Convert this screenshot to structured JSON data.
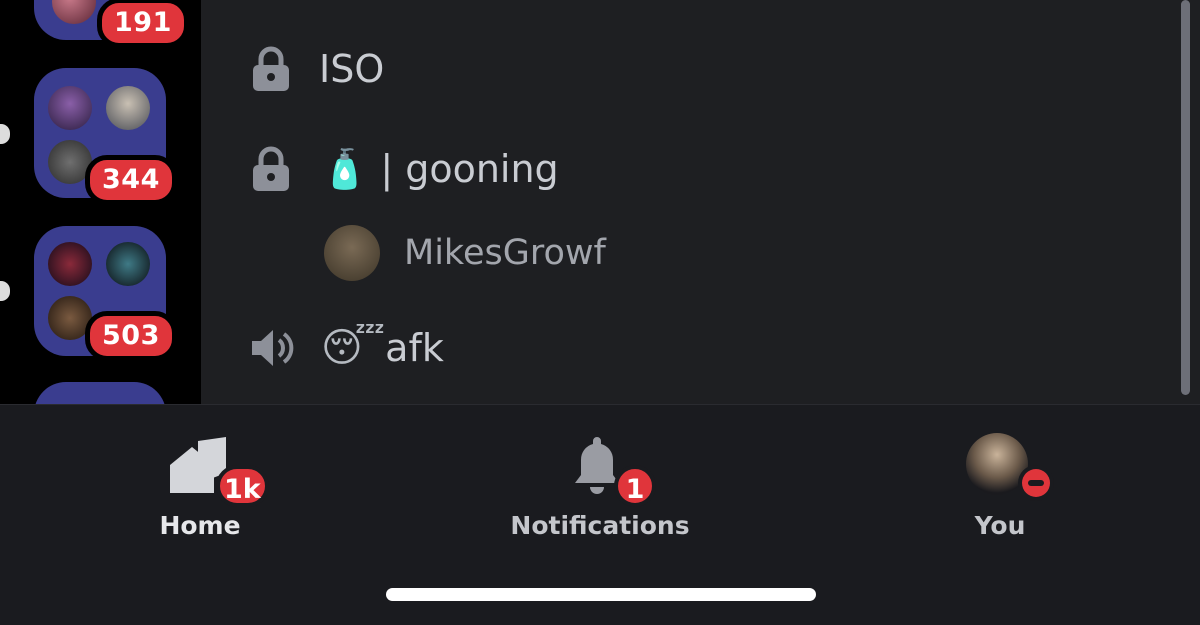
{
  "server_rail": {
    "folders": [
      {
        "badge": "191"
      },
      {
        "badge": "344"
      },
      {
        "badge": "503"
      }
    ]
  },
  "channels": [
    {
      "icon": "lock-icon",
      "name": "ISO"
    },
    {
      "icon": "lock-icon",
      "emoji": "🧴",
      "name": "| gooning"
    },
    {
      "icon": "speaker-icon",
      "emoji": "😴",
      "name": "afk"
    }
  ],
  "voice_user": {
    "name": "MikesGrowf"
  },
  "bottom_nav": {
    "home": {
      "label": "Home",
      "badge": "1k"
    },
    "notifications": {
      "label": "Notifications",
      "badge": "1"
    },
    "you": {
      "label": "You",
      "status": "do-not-disturb"
    }
  },
  "colors": {
    "badge": "#e0353b",
    "folder": "#3a3d8f",
    "channel_bg": "#1e1f22",
    "nav_bg": "#1a1b1f"
  }
}
